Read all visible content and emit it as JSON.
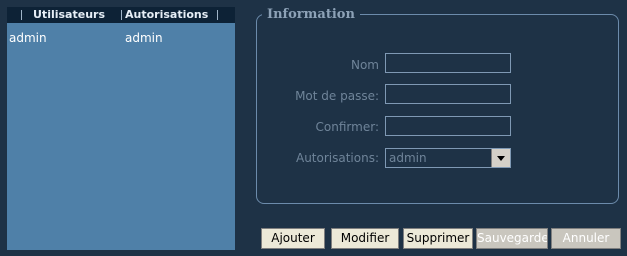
{
  "user_list": {
    "columns": [
      "Utilisateurs",
      "Autorisations"
    ],
    "rows": [
      {
        "user": "admin",
        "autorisation": "admin"
      }
    ]
  },
  "info": {
    "legend": "Information",
    "fields": {
      "nom_label": "Nom",
      "nom_value": "",
      "password_label": "Mot de passe:",
      "password_value": "",
      "confirm_label": "Confirmer:",
      "confirm_value": "",
      "auth_label": "Autorisations:",
      "auth_value": "admin"
    }
  },
  "buttons": {
    "ajouter": "Ajouter",
    "modifier": "Modifier",
    "supprimer": "Supprimer",
    "sauvegarder": "Sauvegarder",
    "annuler": "Annuler"
  },
  "icons": {
    "select_arrow": "chevron-down-icon"
  }
}
